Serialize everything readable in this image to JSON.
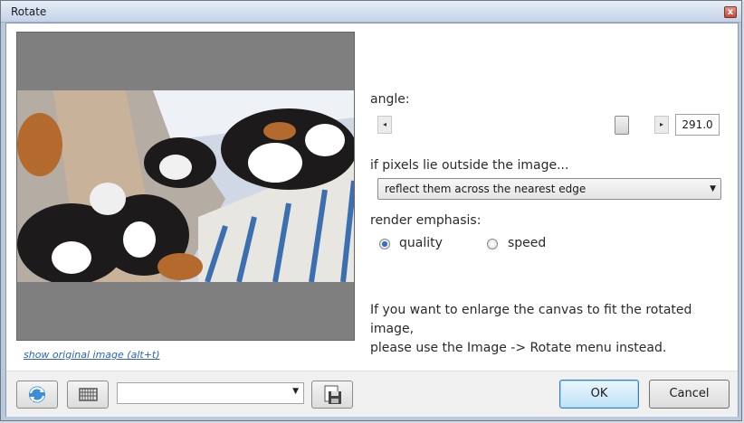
{
  "window": {
    "title": "Rotate",
    "close_glyph": "x"
  },
  "preview": {
    "show_original_link": "show original image (alt+t)"
  },
  "angle": {
    "label": "angle:",
    "left_arrow": "◂",
    "right_arrow": "▸",
    "value": "291.0"
  },
  "edge": {
    "label": "if pixels lie outside the image...",
    "selected": "reflect them across the nearest edge"
  },
  "render": {
    "label": "render emphasis:",
    "options": [
      {
        "label": "quality",
        "checked": true
      },
      {
        "label": "speed",
        "checked": false
      }
    ]
  },
  "info": {
    "line1": "If you want to enlarge the canvas to fit the rotated image,",
    "line2": "please use the Image -> Rotate menu instead."
  },
  "buttons": {
    "ok": "OK",
    "cancel": "Cancel"
  },
  "icons": {
    "refresh": "refresh-icon",
    "grid": "grid-icon",
    "save": "save-icon",
    "dropdown": "chevron-down-icon"
  },
  "colors": {
    "accent": "#2c64b5",
    "preview_bg": "#7f7f7f"
  }
}
